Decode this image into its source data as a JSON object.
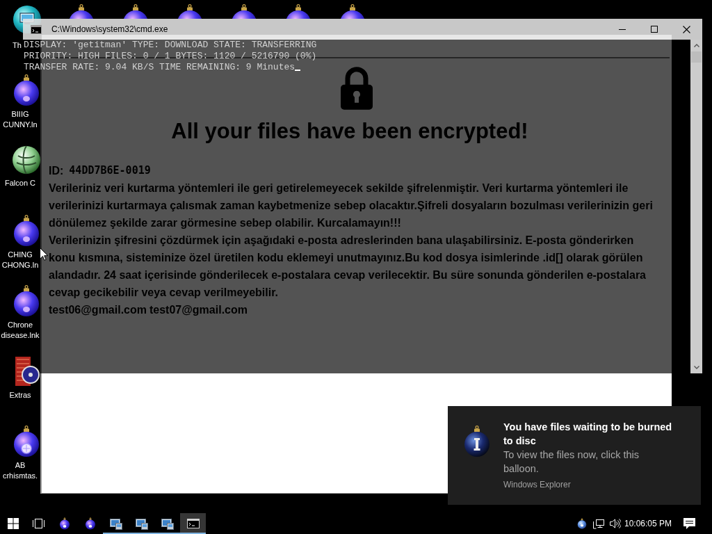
{
  "desktop": {
    "top_row": [
      {
        "kind": "pc",
        "label": "Th"
      },
      {
        "kind": "ornament"
      },
      {
        "kind": "ornament"
      },
      {
        "kind": "ornament"
      },
      {
        "kind": "ornament"
      },
      {
        "kind": "ornament"
      },
      {
        "kind": "ornament"
      }
    ],
    "left_column": [
      {
        "kind": "ornament",
        "label": "BIIIG CUNNY.ln"
      },
      {
        "kind": "globe",
        "label": "Falcon C"
      },
      {
        "kind": "ornament",
        "label": "CHING CHONG.ln"
      },
      {
        "kind": "ornament",
        "label": "Chrone disease.lnk"
      },
      {
        "kind": "disc_case",
        "label": "Extras"
      },
      {
        "kind": "ornament_pattern",
        "label": "AB crhismtas."
      }
    ]
  },
  "console_window": {
    "title": "C:\\Windows\\system32\\cmd.exe",
    "lines": [
      "DISPLAY: 'getitman' TYPE: DOWNLOAD STATE: TRANSFERRING",
      "PRIORITY: HIGH FILES: 0 / 1 BYTES: 1120 / 5216790 (0%)",
      "TRANSFER RATE: 9.04 KB/S TIME REMAINING: 9 Minutes"
    ],
    "cursor": true
  },
  "ransom_window": {
    "heading": "All your files have been encrypted!",
    "id_label": "ID:",
    "id_value": "44DD7B6E-0019",
    "paragraphs": [
      "Verileriniz veri kurtarma yöntemleri ile geri getirelemeyecek sekilde şifrelenmiştir. Veri kurtarma yöntemleri ile verilerinizi kurtarmaya çalısmak zaman kaybetmenize sebep olacaktır.Şifreli dosyaların bozulması verilerinizin geri dönülemez şekilde zarar görmesine sebep olabilir. Kurcalamayın!!!",
      "Verilerinizin şifresini çözdürmek için aşağıdaki e-posta adreslerinden bana ulaşabilirsiniz. E-posta gönderirken konu kısmına, sisteminize özel üretilen kodu eklemeyi unutmayınız.Bu kod dosya isimlerinde .id[] olarak görülen alandadır. 24 saat içerisinde gönderilecek e-postalara cevap verilecektir. Bu süre sonunda gönderilen e-postalara cevap gecikebilir veya cevap verilmeyebilir."
    ],
    "emails": [
      "test06@gmail.com",
      "test07@gmail.com"
    ]
  },
  "notification": {
    "title": "You have files waiting to be burned to disc",
    "body": "To view the files now, click this balloon.",
    "source": "Windows Explorer"
  },
  "taskbar": {
    "items": [
      {
        "kind": "start",
        "running": false,
        "selected": false
      },
      {
        "kind": "task_view",
        "running": false,
        "selected": false
      },
      {
        "kind": "ornament",
        "running": false,
        "selected": false
      },
      {
        "kind": "ornament",
        "running": false,
        "selected": false
      },
      {
        "kind": "program",
        "running": true,
        "selected": false
      },
      {
        "kind": "program",
        "running": true,
        "selected": false
      },
      {
        "kind": "program",
        "running": true,
        "selected": false
      },
      {
        "kind": "console",
        "running": true,
        "selected": true
      }
    ],
    "tray": [
      {
        "kind": "ornament"
      },
      {
        "kind": "network"
      },
      {
        "kind": "volume"
      }
    ],
    "clock": "10:06:05 PM"
  }
}
